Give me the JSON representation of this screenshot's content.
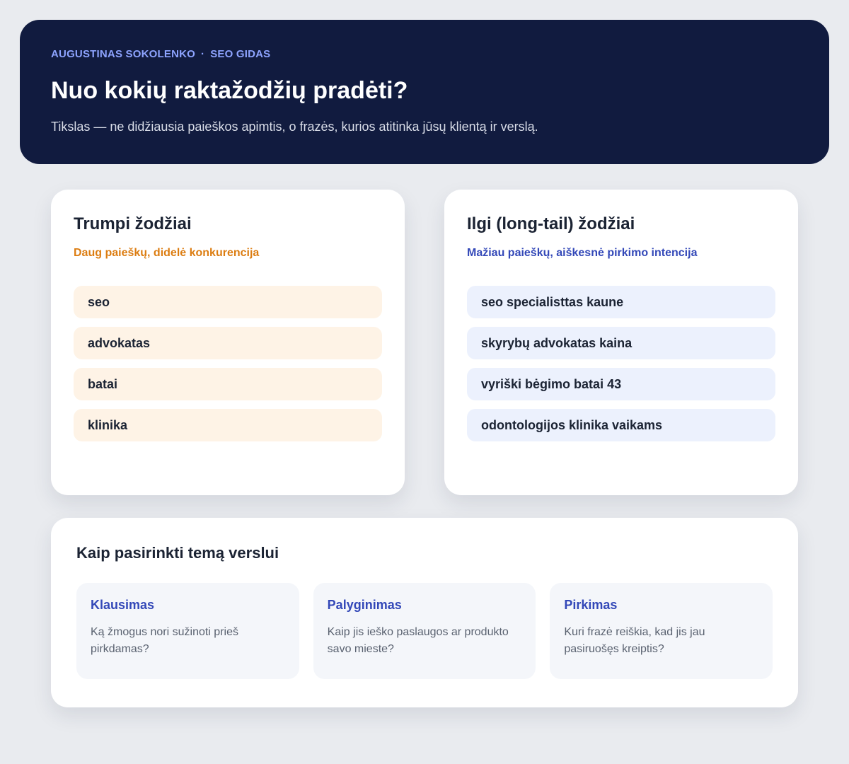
{
  "header": {
    "author": "AUGUSTINAS SOKOLENKO",
    "separator": "·",
    "section": "SEO GIDAS",
    "title": "Nuo kokių raktažodžių pradėti?",
    "subtitle": "Tikslas — ne didžiausia paieškos apimtis, o frazės, kurios atitinka jūsų klientą ir verslą."
  },
  "short_keywords": {
    "title": "Trumpi žodžiai",
    "subtitle": "Daug paieškų, didelė konkurencija",
    "accent_color": "#dc7d12",
    "items": [
      "seo",
      "advokatas",
      "batai",
      "klinika"
    ]
  },
  "long_keywords": {
    "title": "Ilgi (long-tail) žodžiai",
    "subtitle": "Mažiau paieškų, aiškesnė pirkimo intencija",
    "accent_color": "#3348b8",
    "items": [
      "seo specialisttas kaune",
      "skyrybų advokatas kaina",
      "vyriški bėgimo batai 43",
      "odontologijos klinika vaikams"
    ]
  },
  "topics": {
    "title": "Kaip pasirinkti temą verslui",
    "items": [
      {
        "title": "Klausimas",
        "text": "Ką žmogus nori sužinoti prieš pirkdamas?"
      },
      {
        "title": "Palyginimas",
        "text": "Kaip jis ieško paslaugos ar produkto savo mieste?"
      },
      {
        "title": "Pirkimas",
        "text": "Kuri frazė reiškia, kad jis jau pasiruošęs kreiptis?"
      }
    ]
  }
}
